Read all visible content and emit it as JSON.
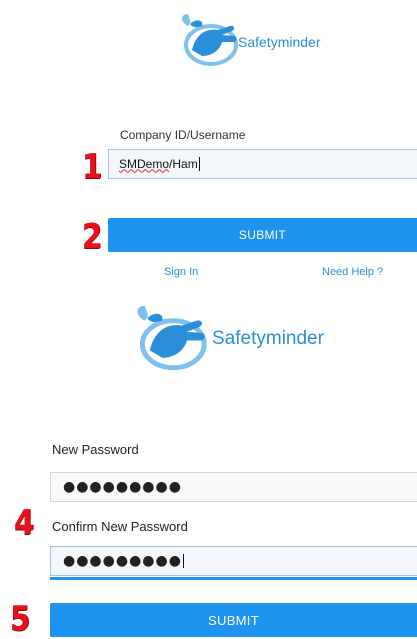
{
  "screen_one": {
    "logo_text": "Safetyminder",
    "username_label": "Company ID/Username",
    "username_value_prefix": "SMDemo",
    "username_value_suffix": "/Ham",
    "submit_label": "SUBMIT",
    "sign_in_link": "Sign In",
    "need_help_link": "Need Help ?"
  },
  "screen_two": {
    "logo_text": "Safetyminder",
    "new_password_label": "New Password",
    "new_password_value": "●●●●●●●●●",
    "confirm_password_label": "Confirm New Password",
    "confirm_password_value": "●●●●●●●●●",
    "submit_label": "SUBMIT"
  },
  "steps": [
    "1",
    "2",
    "4",
    "5"
  ],
  "colors": {
    "accent": "#1d93f0",
    "brand": "#2a8fd8",
    "step_marker": "#e8101a"
  }
}
